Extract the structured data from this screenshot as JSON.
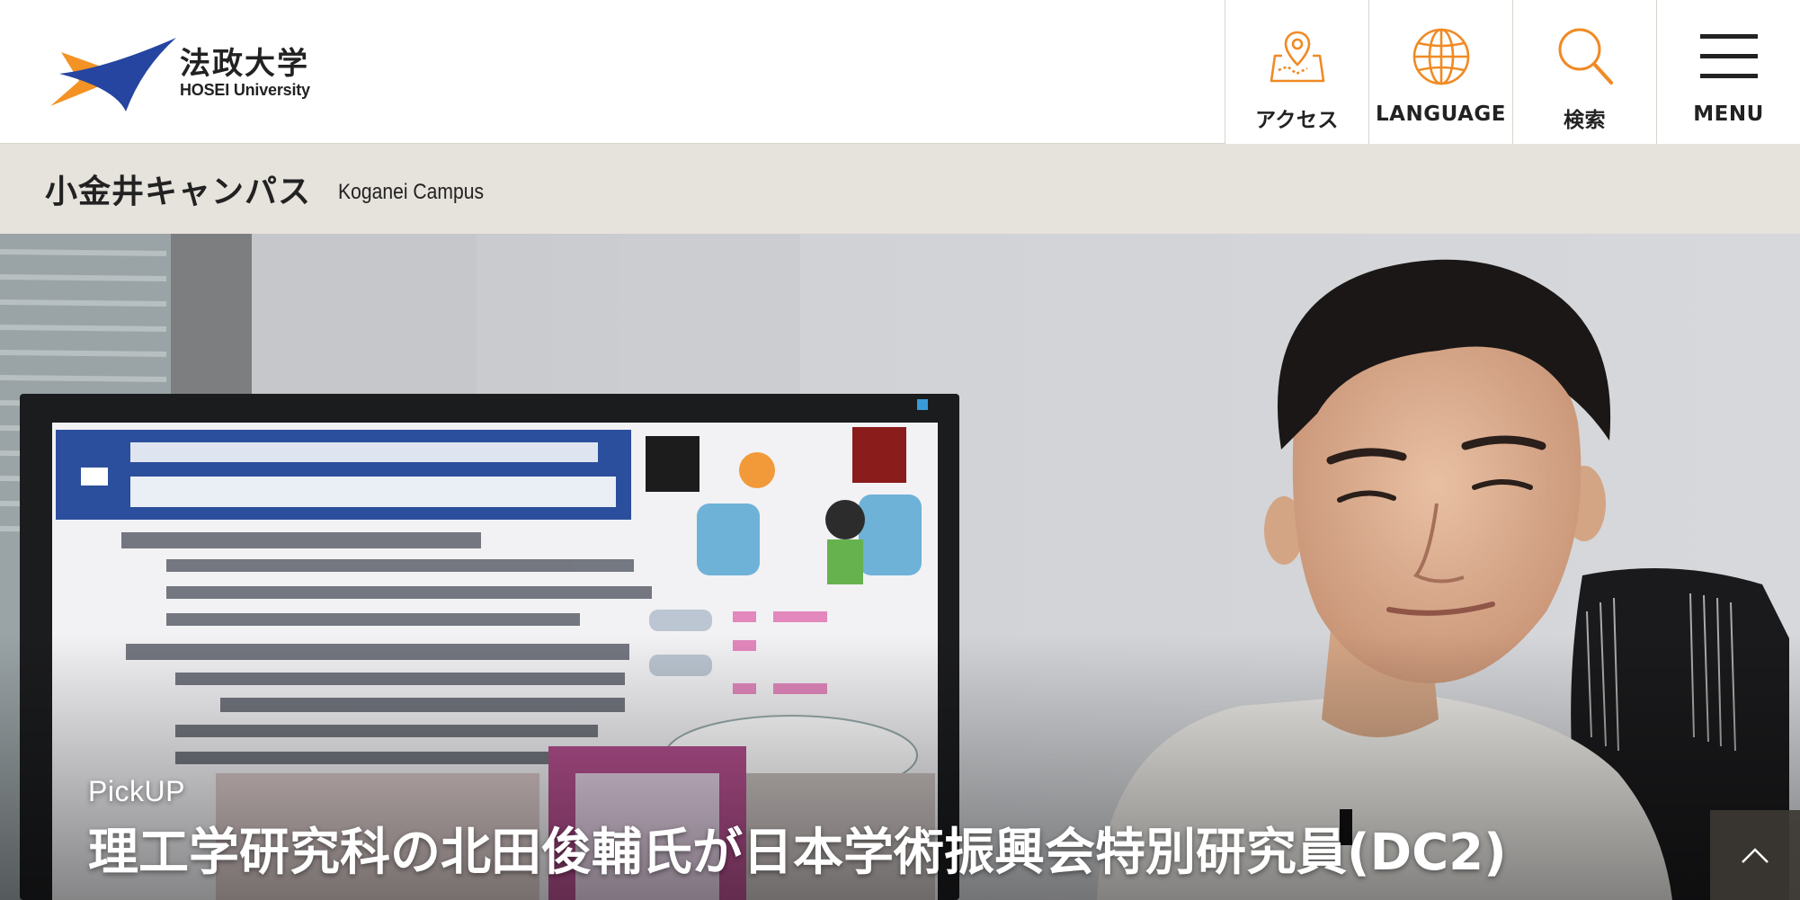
{
  "header": {
    "logo": {
      "name_jp": "法政大学",
      "name_en": "HOSEI University",
      "colors": {
        "orange": "#f39325",
        "navy": "#2545a0"
      }
    },
    "nav": [
      {
        "label": "アクセス",
        "icon": "map-pin-icon"
      },
      {
        "label": "LANGUAGE",
        "icon": "globe-icon"
      },
      {
        "label": "検索",
        "icon": "search-icon"
      },
      {
        "label": "MENU",
        "icon": "hamburger-menu-icon"
      }
    ],
    "icon_color": "#f08a24"
  },
  "campus": {
    "name_jp": "小金井キャンパス",
    "name_en": "Koganei Campus"
  },
  "hero": {
    "tag": "PickUP",
    "title": "理工学研究科の北田俊輔氏が日本学術振興会特別研究員(DC2)"
  },
  "scroll_top": {
    "icon": "chevron-up-icon"
  }
}
